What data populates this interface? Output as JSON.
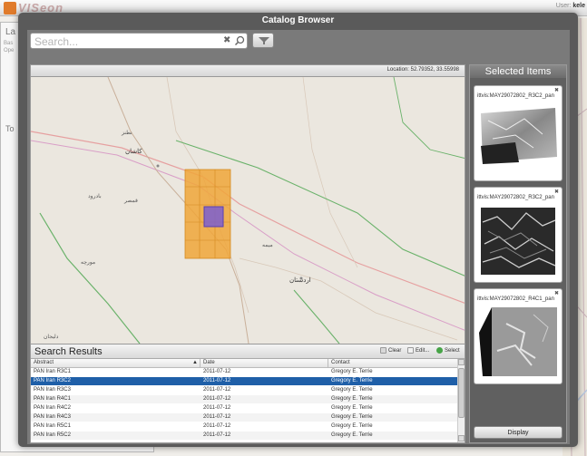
{
  "app": {
    "logo": "VISeon",
    "user_label": "User:",
    "user_name": "kele"
  },
  "background": {
    "layers_abbr": "La",
    "layers_text": "Bas\nOpe",
    "tools_abbr": "To"
  },
  "dialog": {
    "title": "Catalog Browser"
  },
  "search": {
    "placeholder": "Search...",
    "value": "",
    "clear_icon": "clear-icon",
    "search_icon": "magnifier-icon"
  },
  "filter": {
    "icon": "funnel-icon"
  },
  "map": {
    "location_text": "Location: 52.79352, 33.55998",
    "labels": [
      "نطنز",
      "کاشان",
      "قمصر",
      "بادرود",
      "میمه",
      "اردستان",
      "مورچه",
      "دلیجان"
    ]
  },
  "results": {
    "title": "Search Results",
    "buttons": {
      "clear": "Clear",
      "edit": "Edit...",
      "select": "Select"
    },
    "columns": {
      "abstract": "Abstract",
      "date": "Date",
      "contact": "Contact"
    },
    "rows": [
      {
        "abstract": "PAN Iran R3C1",
        "date": "2011-07-12",
        "contact": "Gregory E. Terrie"
      },
      {
        "abstract": "PAN Iran R3C2",
        "date": "2011-07-12",
        "contact": "Gregory E. Terrie"
      },
      {
        "abstract": "PAN Iran R3C3",
        "date": "2011-07-12",
        "contact": "Gregory E. Terrie"
      },
      {
        "abstract": "PAN Iran R4C1",
        "date": "2011-07-12",
        "contact": "Gregory E. Terrie"
      },
      {
        "abstract": "PAN Iran R4C2",
        "date": "2011-07-12",
        "contact": "Gregory E. Terrie"
      },
      {
        "abstract": "PAN Iran R4C3",
        "date": "2011-07-12",
        "contact": "Gregory E. Terrie"
      },
      {
        "abstract": "PAN Iran R5C1",
        "date": "2011-07-12",
        "contact": "Gregory E. Terrie"
      },
      {
        "abstract": "PAN Iran R5C2",
        "date": "2011-07-12",
        "contact": "Gregory E. Terrie"
      }
    ],
    "selected_index": 1
  },
  "selected_items": {
    "title": "Selected Items",
    "items": [
      {
        "name": "ittvis:MAY29072802_R3C2_pan"
      },
      {
        "name": "ittvis:MAY29072802_R3C2_pan"
      },
      {
        "name": "ittvis:MAY29072802_R4C1_pan"
      }
    ],
    "display_label": "Display"
  },
  "colors": {
    "selection": "#1f5fa8",
    "footprint": "#f0a63a",
    "highlight": "#7b5fd0"
  }
}
